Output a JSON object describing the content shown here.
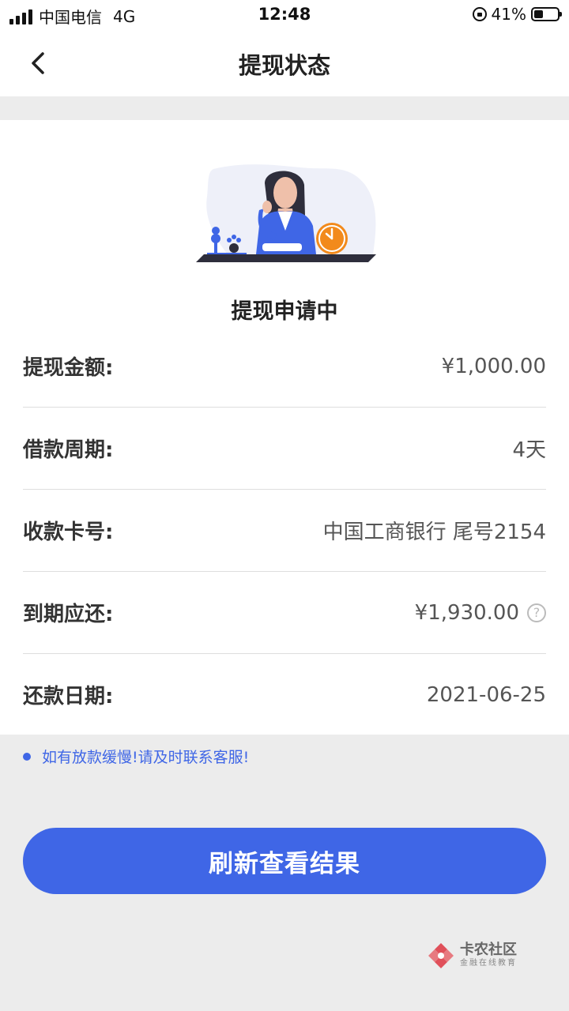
{
  "status_bar": {
    "carrier": "中国电信",
    "network": "4G",
    "time": "12:48",
    "battery_percent": "41%",
    "battery_level": 0.41
  },
  "nav": {
    "title": "提现状态",
    "back_icon": "chevron-left-icon"
  },
  "status": {
    "title": "提现申请中"
  },
  "rows": [
    {
      "label": "提现金额:",
      "value": "¥1,000.00"
    },
    {
      "label": "借款周期:",
      "value": "4天"
    },
    {
      "label": "收款卡号:",
      "value": "中国工商银行 尾号2154"
    },
    {
      "label": "到期应还:",
      "value": "¥1,930.00",
      "help_icon": "?"
    },
    {
      "label": "还款日期:",
      "value": "2021-06-25"
    }
  ],
  "notice": {
    "text": "如有放款缓慢!请及时联系客服!"
  },
  "refresh_button": {
    "label": "刷新查看结果"
  },
  "watermark": {
    "title": "卡农社区",
    "subtitle": "金融在线教育"
  },
  "colors": {
    "accent": "#3f66e6",
    "clock": "#f28a1c"
  }
}
